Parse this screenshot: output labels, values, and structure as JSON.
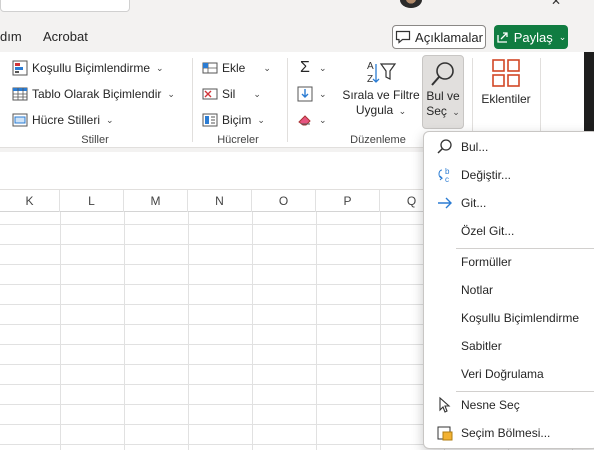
{
  "window": {
    "close_glyph": "✕"
  },
  "tabs": [
    {
      "label": "dım"
    },
    {
      "label": "Acrobat"
    }
  ],
  "header_buttons": {
    "comments_label": "Açıklamalar",
    "share_label": "Paylaş"
  },
  "ribbon": {
    "styles": {
      "group_label": "Stiller",
      "items": [
        {
          "label": "Koşullu Biçimlendirme",
          "icon": "conditional-formatting-icon"
        },
        {
          "label": "Tablo Olarak Biçimlendir",
          "icon": "format-as-table-icon"
        },
        {
          "label": "Hücre Stilleri",
          "icon": "cell-styles-icon"
        }
      ]
    },
    "cells": {
      "group_label": "Hücreler",
      "items": [
        {
          "label": "Ekle",
          "icon": "insert-icon"
        },
        {
          "label": "Sil",
          "icon": "delete-icon"
        },
        {
          "label": "Biçim",
          "icon": "format-icon"
        }
      ]
    },
    "editing": {
      "group_label": "Düzenleme",
      "sort_filter_line1": "Sırala ve Filtre",
      "sort_filter_line2": "Uygula",
      "find_select_line1": "Bul ve",
      "find_select_line2": "Seç"
    },
    "addins": {
      "label": "Eklentiler"
    }
  },
  "columns": [
    "K",
    "L",
    "M",
    "N",
    "O",
    "P",
    "Q"
  ],
  "menu": {
    "items": [
      {
        "label": "Bul...",
        "icon": "search-icon"
      },
      {
        "label": "Değiştir...",
        "icon": "replace-icon"
      },
      {
        "label": "Git...",
        "icon": "arrow-right-icon"
      },
      {
        "label": "Özel Git...",
        "icon": ""
      },
      {
        "label": "Formüller",
        "icon": ""
      },
      {
        "label": "Notlar",
        "icon": ""
      },
      {
        "label": "Koşullu Biçimlendirme",
        "icon": ""
      },
      {
        "label": "Sabitler",
        "icon": ""
      },
      {
        "label": "Veri Doğrulama",
        "icon": ""
      },
      {
        "label": "Nesne Seç",
        "icon": "pointer-icon"
      },
      {
        "label": "Seçim Bölmesi...",
        "icon": "selection-pane-icon"
      }
    ]
  },
  "colors": {
    "accent_green": "#107c41",
    "accent_blue": "#2b7cd3",
    "menu_separator": "#d2d0ce"
  }
}
